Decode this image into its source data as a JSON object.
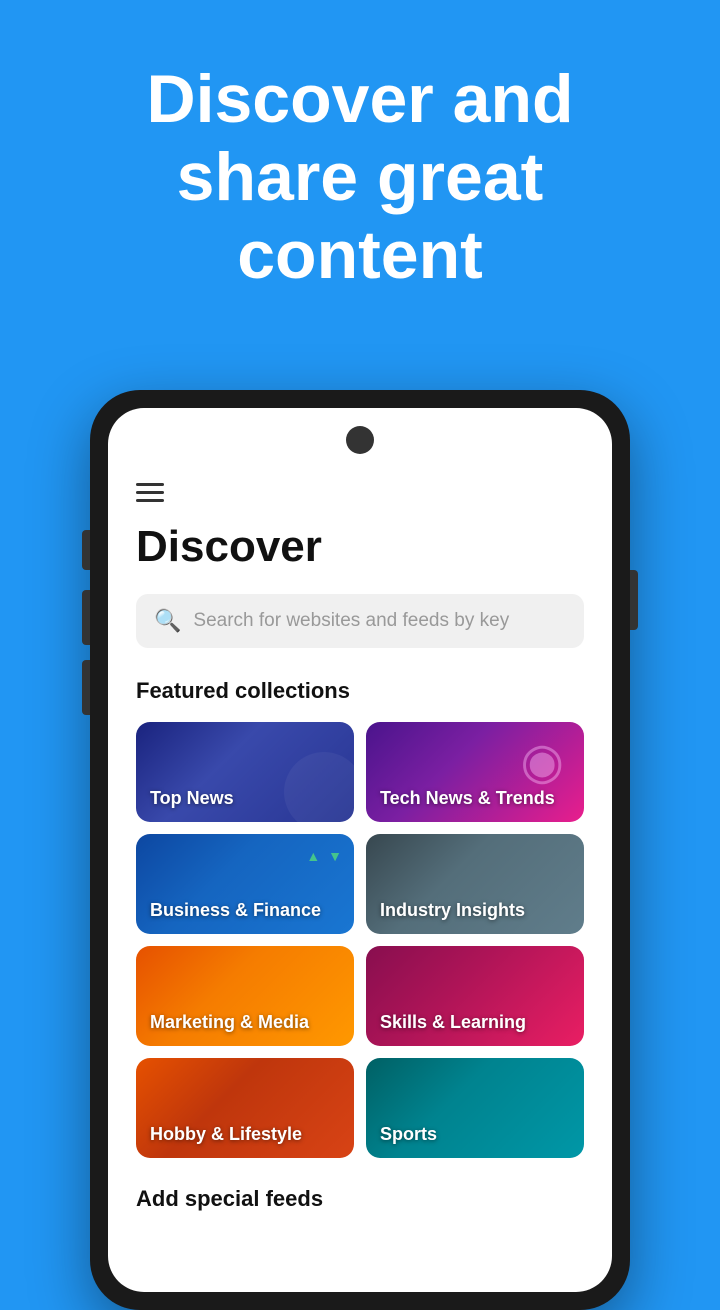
{
  "hero": {
    "title": "Discover and share great content"
  },
  "app": {
    "page_title": "Discover",
    "search_placeholder": "Search for websites and feeds by key"
  },
  "sections": {
    "featured_collections": "Featured collections",
    "add_special_feeds": "Add special feeds"
  },
  "collections": [
    {
      "id": "top-news",
      "label": "Top News",
      "class": "card-top-news"
    },
    {
      "id": "tech-news",
      "label": "Tech News & Trends",
      "class": "card-tech-news"
    },
    {
      "id": "business",
      "label": "Business & Finance",
      "class": "card-business"
    },
    {
      "id": "industry",
      "label": "Industry Insights",
      "class": "card-industry"
    },
    {
      "id": "marketing",
      "label": "Marketing & Media",
      "class": "card-marketing"
    },
    {
      "id": "skills",
      "label": "Skills & Learning",
      "class": "card-skills"
    },
    {
      "id": "hobby",
      "label": "Hobby & Lifestyle",
      "class": "card-hobby"
    },
    {
      "id": "sports",
      "label": "Sports",
      "class": "card-sports"
    }
  ],
  "icons": {
    "hamburger": "≡",
    "search": "🔍"
  }
}
